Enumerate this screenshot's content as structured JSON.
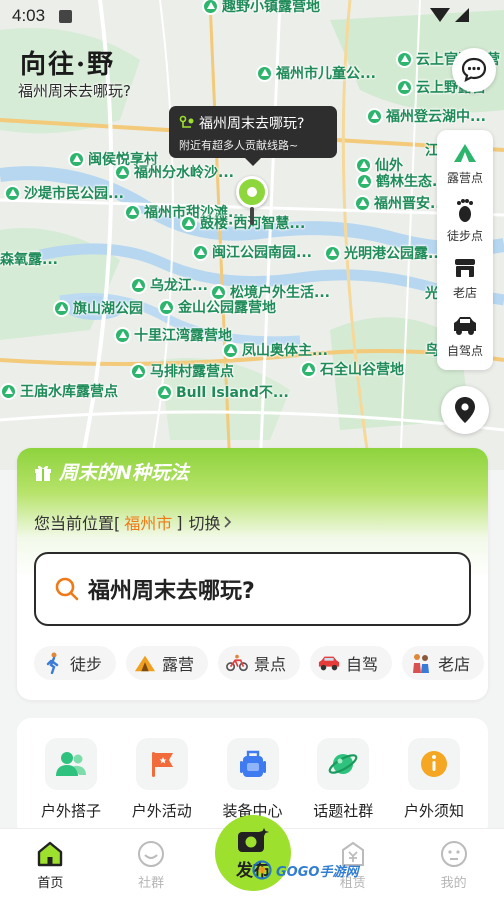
{
  "status_bar": {
    "time": "4:03"
  },
  "header": {
    "logo_text": "向往·野",
    "subtitle": "福州周末去哪玩?"
  },
  "tooltip": {
    "title": "福州周末去哪玩?",
    "desc": "附近有超多人贡献线路~"
  },
  "map_pois": [
    "趣野小镇露营地",
    "福州市儿童公...",
    "云上官洞露营",
    "云上野露营",
    "福州登云湖中...",
    "闽侯悦享村",
    "福州分水岭沙...",
    "仙外",
    "鹤林生态...",
    "福州晋安...",
    "沙堤市民公园...",
    "福州市甜沙滩...",
    "鼓楼·西河智慧...",
    "森氧露...",
    "闽江公园南园...",
    "光明港公园露...",
    "乌龙江...",
    "松境户外生活...",
    "旗山湖公园",
    "金山公园露营地",
    "十里江湾露营地",
    "凤山奥体主...",
    "马排村露营点",
    "石全山谷营地",
    "王庙水库露营点",
    "Bull Island不...",
    "江滨露营",
    "光明港...",
    "鸟语林"
  ],
  "side_tools": [
    {
      "label": "露营点",
      "icon": "tent-icon"
    },
    {
      "label": "徒步点",
      "icon": "footprint-icon"
    },
    {
      "label": "老店",
      "icon": "shop-icon"
    },
    {
      "label": "自驾点",
      "icon": "car-icon"
    }
  ],
  "panel": {
    "title": "周末的N种玩法",
    "location_prefix": "您当前位置[",
    "city": "福州市",
    "location_suffix": "]",
    "switch_label": "切换",
    "search_text": "福州周末去哪玩?",
    "chips": [
      {
        "label": "徒步",
        "icon": "hiker-icon"
      },
      {
        "label": "露营",
        "icon": "tent-icon"
      },
      {
        "label": "景点",
        "icon": "bike-icon"
      },
      {
        "label": "自驾",
        "icon": "car-icon"
      },
      {
        "label": "老店",
        "icon": "people-icon"
      }
    ]
  },
  "services": [
    {
      "label": "户外搭子",
      "icon": "partner-icon",
      "color": "#2ec27e"
    },
    {
      "label": "户外活动",
      "icon": "flag-icon",
      "color": "#f26b3a"
    },
    {
      "label": "装备中心",
      "icon": "backpack-icon",
      "color": "#3e7bf0"
    },
    {
      "label": "话题社群",
      "icon": "planet-icon",
      "color": "#2ec27e"
    },
    {
      "label": "户外须知",
      "icon": "info-icon",
      "color": "#f5a623"
    }
  ],
  "tabs": [
    {
      "label": "首页",
      "icon": "home-icon"
    },
    {
      "label": "社群",
      "icon": "smile-icon"
    },
    {
      "label": "",
      "icon": ""
    },
    {
      "label": "租赁",
      "icon": "rent-icon"
    },
    {
      "label": "我的",
      "icon": "profile-icon"
    }
  ],
  "post_button": {
    "label": "发布"
  },
  "watermark": {
    "text": "GOGO手游网"
  },
  "colors": {
    "accent": "#8ed33d",
    "poi": "#2db56e",
    "city": "#f07a18"
  }
}
